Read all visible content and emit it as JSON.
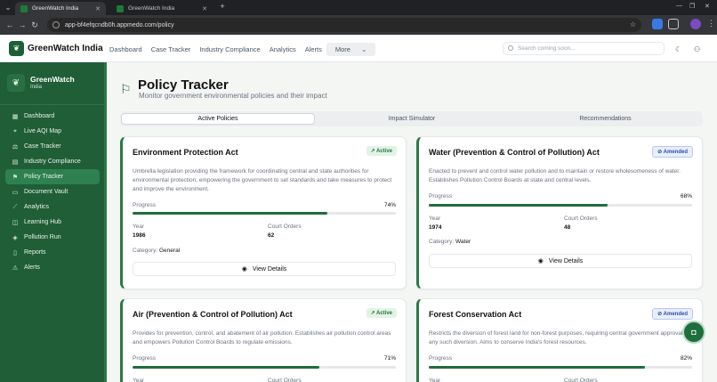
{
  "browser": {
    "tabs": [
      {
        "title": "GreenWatch India"
      },
      {
        "title": "GreenWatch India"
      }
    ],
    "url": "app-bf4efqcndb0h.appmedo.com/policy"
  },
  "header": {
    "brand": "GreenWatch India",
    "nav": [
      "Dashboard",
      "Case Tracker",
      "Industry Compliance",
      "Analytics",
      "Alerts"
    ],
    "more_label": "More",
    "search_placeholder": "Search coming soon..."
  },
  "sidebar": {
    "title": "GreenWatch",
    "subtitle": "India",
    "items": [
      {
        "label": "Dashboard",
        "icon": "grid-icon"
      },
      {
        "label": "Live AQI Map",
        "icon": "map-icon"
      },
      {
        "label": "Case Tracker",
        "icon": "scale-icon"
      },
      {
        "label": "Industry Compliance",
        "icon": "factory-icon"
      },
      {
        "label": "Policy Tracker",
        "icon": "flag-icon"
      },
      {
        "label": "Document Vault",
        "icon": "folder-icon"
      },
      {
        "label": "Analytics",
        "icon": "chart-icon"
      },
      {
        "label": "Learning Hub",
        "icon": "book-icon"
      },
      {
        "label": "Pollution Run",
        "icon": "game-icon"
      },
      {
        "label": "Reports",
        "icon": "document-icon"
      },
      {
        "label": "Alerts",
        "icon": "bell-icon"
      }
    ],
    "active": "Policy Tracker"
  },
  "page": {
    "title": "Policy Tracker",
    "subtitle": "Monitor government environmental policies and their impact",
    "tabs": [
      "Active Policies",
      "Impact Simulator",
      "Recommendations"
    ]
  },
  "labels": {
    "progress": "Progress",
    "year": "Year",
    "court_orders": "Court Orders",
    "category": "Category:",
    "view_details": "View Details"
  },
  "policies": [
    {
      "title": "Environment Protection Act",
      "status": "Active",
      "description": "Umbrella legislation providing the framework for coordinating central and state authorities for environmental protection, empowering the government to set standards and take measures to protect and improve the environment.",
      "progress": 74,
      "progress_text": "74%",
      "year": "1986",
      "court_orders": "62",
      "category": "General"
    },
    {
      "title": "Water (Prevention & Control of Pollution) Act",
      "status": "Amended",
      "description": "Enacted to prevent and control water pollution and to maintain or restore wholesomeness of water. Establishes Pollution Control Boards at state and central levels.",
      "progress": 68,
      "progress_text": "68%",
      "year": "1974",
      "court_orders": "48",
      "category": "Water"
    },
    {
      "title": "Air (Prevention & Control of Pollution) Act",
      "status": "Active",
      "description": "Provides for prevention, control, and abatement of air pollution. Establishes air pollution control areas and empowers Pollution Control Boards to regulate emissions.",
      "progress": 71,
      "progress_text": "71%",
      "year": "",
      "court_orders": "",
      "category": ""
    },
    {
      "title": "Forest Conservation Act",
      "status": "Amended",
      "description": "Restricts the diversion of forest land for non-forest purposes, requiring central government approval for any such diversion. Aims to conserve India's forest resources.",
      "progress": 82,
      "progress_text": "82%",
      "year": "",
      "court_orders": "",
      "category": ""
    }
  ],
  "colors": {
    "primary": "#1f5e36",
    "accent": "#2a7a45",
    "progress": "#1f6e3d"
  }
}
